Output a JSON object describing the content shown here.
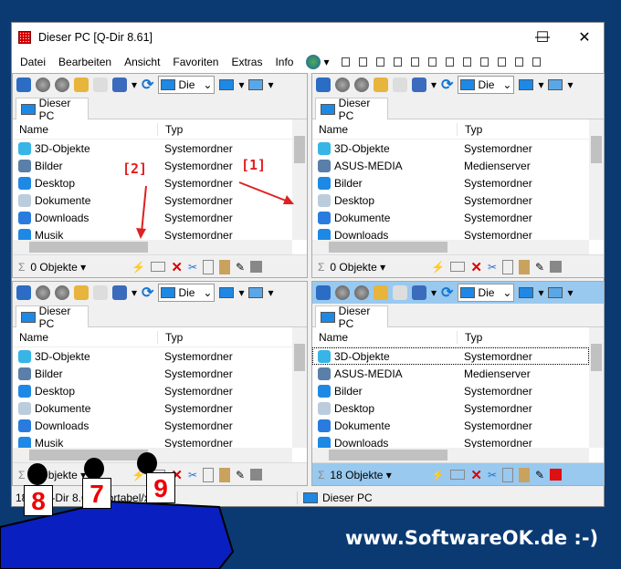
{
  "window": {
    "title": "Dieser PC  [Q-Dir 8.61]",
    "minimize": "—",
    "maximize": "☐",
    "close": "✕"
  },
  "menu": [
    "Datei",
    "Bearbeiten",
    "Ansicht",
    "Favoriten",
    "Extras",
    "Info"
  ],
  "combo_value": "Die",
  "tab_label": "Dieser PC",
  "columns": {
    "name": "Name",
    "type": "Typ"
  },
  "panes": [
    {
      "active": false,
      "count": "0 Objekte",
      "rows": [
        [
          "3D-Objekte",
          "Systemordner"
        ],
        [
          "Bilder",
          "Systemordner"
        ],
        [
          "Desktop",
          "Systemordner"
        ],
        [
          "Dokumente",
          "Systemordner"
        ],
        [
          "Downloads",
          "Systemordner"
        ],
        [
          "Musik",
          "Systemordner"
        ]
      ]
    },
    {
      "active": false,
      "count": "0 Objekte",
      "rows": [
        [
          "3D-Objekte",
          "Systemordner"
        ],
        [
          "ASUS-MEDIA",
          "Medienserver"
        ],
        [
          "Bilder",
          "Systemordner"
        ],
        [
          "Desktop",
          "Systemordner"
        ],
        [
          "Dokumente",
          "Systemordner"
        ],
        [
          "Downloads",
          "Systemordner"
        ]
      ]
    },
    {
      "active": false,
      "count": "0 Objekte",
      "rows": [
        [
          "3D-Objekte",
          "Systemordner"
        ],
        [
          "Bilder",
          "Systemordner"
        ],
        [
          "Desktop",
          "Systemordner"
        ],
        [
          "Dokumente",
          "Systemordner"
        ],
        [
          "Downloads",
          "Systemordner"
        ],
        [
          "Musik",
          "Systemordner"
        ]
      ]
    },
    {
      "active": true,
      "count": "18 Objekte",
      "selected_row": 0,
      "rows": [
        [
          "3D-Objekte",
          "Systemordner"
        ],
        [
          "ASUS-MEDIA",
          "Medienserver"
        ],
        [
          "Bilder",
          "Systemordner"
        ],
        [
          "Desktop",
          "Systemordner"
        ],
        [
          "Dokumente",
          "Systemordner"
        ],
        [
          "Downloads",
          "Systemordner"
        ]
      ]
    }
  ],
  "status": {
    "left": "18 ... Q-Dir 8.61 (Portabel/x64)",
    "location": "Dieser PC"
  },
  "annotations": {
    "a1": "[1]",
    "a2": "[2]"
  },
  "cards": [
    "8",
    "7",
    "9"
  ],
  "brand": "www.SoftwareOK.de :-)",
  "colors": {
    "active_pane": "#99c9ef",
    "background": "#0b3a73",
    "annotation": "#e02020"
  }
}
